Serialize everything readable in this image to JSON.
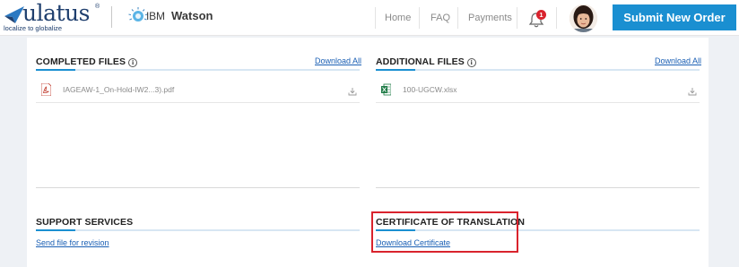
{
  "header": {
    "brand_name": "ulatus",
    "brand_reg": "®",
    "brand_tagline": "localize to globalize",
    "partner_prefix": "IBM",
    "partner_name": "Watson",
    "nav": [
      {
        "label": "Home"
      },
      {
        "label": "FAQ"
      },
      {
        "label": "Payments"
      }
    ],
    "notification_count": "1",
    "submit_label": "Submit New Order"
  },
  "completed_files": {
    "title": "COMPLETED FILES",
    "download_all": "Download All",
    "files": [
      {
        "name": "IAGEAW-1_On-Hold-IW2...3).pdf",
        "type": "pdf"
      }
    ]
  },
  "additional_files": {
    "title": "ADDITIONAL FILES",
    "download_all": "Download All",
    "files": [
      {
        "name": "100-UGCW.xlsx",
        "type": "xlsx"
      }
    ]
  },
  "support_services": {
    "title": "SUPPORT SERVICES",
    "link": "Send file for revision"
  },
  "certificate": {
    "title": "CERTIFICATE OF TRANSLATION",
    "link": "Download Certificate"
  },
  "colors": {
    "brand_blue": "#1a8fd1",
    "link_blue": "#1a5fb4",
    "highlight_red": "#d9232d"
  },
  "icons": {
    "info": "i",
    "pdf_file": "pdf-icon",
    "excel_file": "excel-icon",
    "download": "download-icon",
    "bell": "bell-icon"
  }
}
